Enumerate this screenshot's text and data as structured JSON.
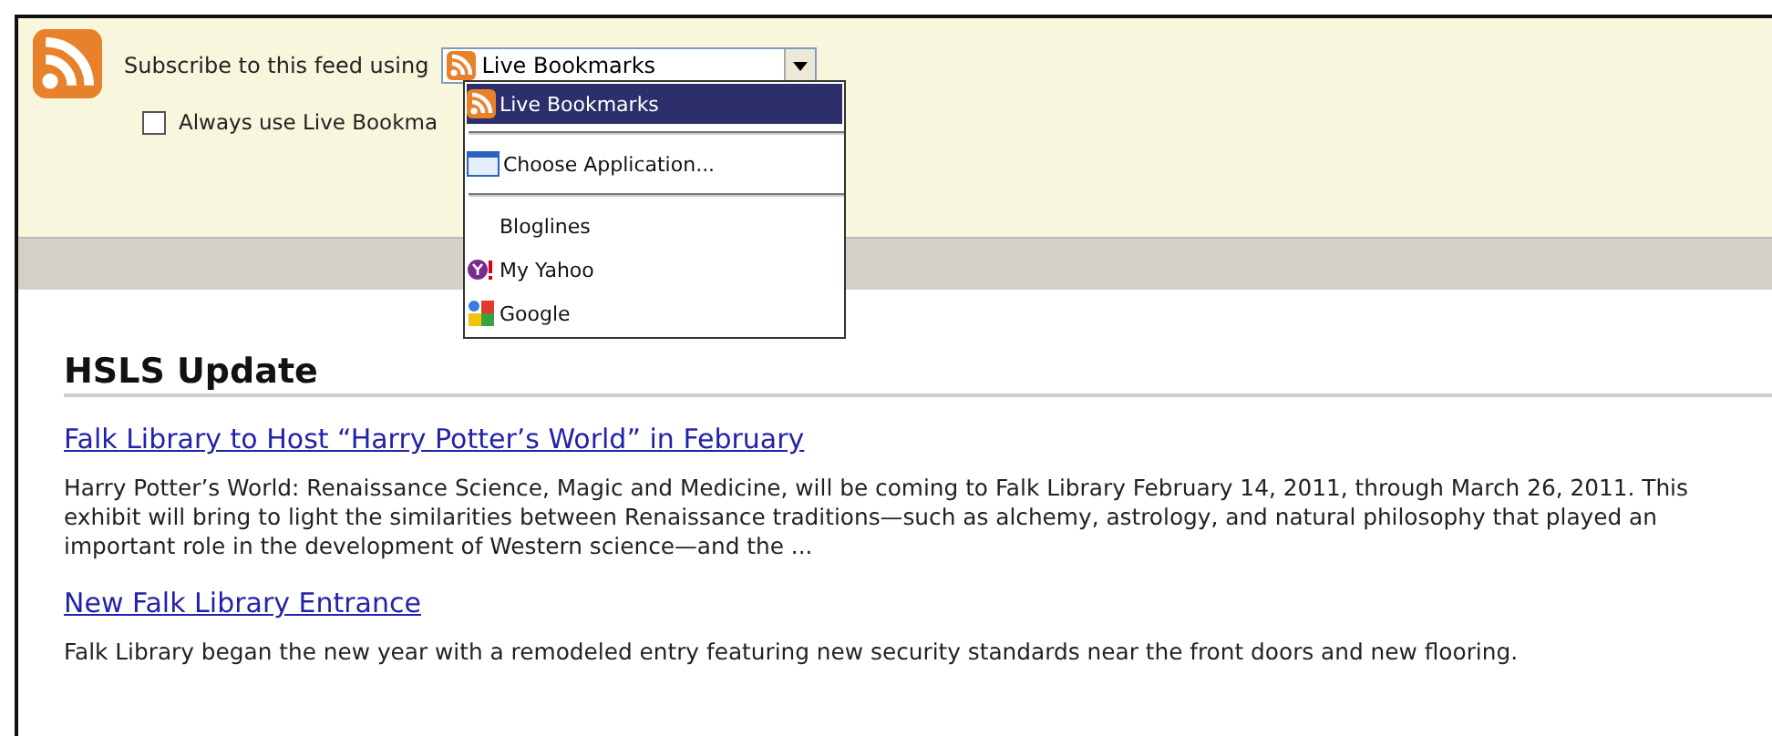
{
  "subscribe": {
    "label": "Subscribe to this feed using",
    "select_value": "Live Bookmarks",
    "checkbox": {
      "label": "Always use Live Bookma",
      "checked": false
    }
  },
  "dropdown": {
    "items": [
      {
        "kind": "option",
        "label": "Live Bookmarks",
        "selected": true
      },
      {
        "kind": "separator"
      },
      {
        "kind": "option",
        "label": "Choose Application...",
        "selected": false
      },
      {
        "kind": "separator"
      },
      {
        "kind": "option",
        "label": "Bloglines",
        "selected": false
      },
      {
        "kind": "option",
        "label": "My Yahoo",
        "selected": false
      },
      {
        "kind": "option",
        "label": "Google",
        "selected": false
      }
    ]
  },
  "feed": {
    "title": "HSLS Update",
    "entries": [
      {
        "title": "Falk Library to Host “Harry Potter’s World” in February",
        "summary": "Harry Potter’s World: Renaissance Science, Magic and Medicine, will be coming to Falk Library February 14, 2011, through March 26, 2011. This exhibit will bring to light the similarities between Renaissance traditions—such as alchemy, astrology, and natural philosophy that played an important role in the development of Western science—and the ..."
      },
      {
        "title": "New Falk Library Entrance",
        "summary": "Falk Library began the new year with a remodeled entry featuring new security standards near the front doors and new flooring."
      }
    ]
  }
}
